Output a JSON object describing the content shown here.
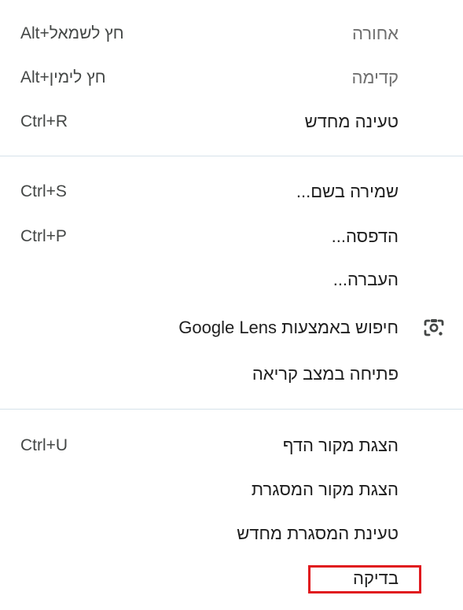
{
  "menu": {
    "items": [
      {
        "label": "אחורה",
        "shortcut": "Alt+חץ לשמאל"
      },
      {
        "label": "קדימה",
        "shortcut": "Alt+חץ לימין"
      },
      {
        "label": "טעינה מחדש",
        "shortcut": "Ctrl+R"
      },
      {
        "label": "שמירה בשם...",
        "shortcut": "Ctrl+S"
      },
      {
        "label": "הדפסה...",
        "shortcut": "Ctrl+P"
      },
      {
        "label": "העברה..."
      },
      {
        "label": "חיפוש באמצעות Google Lens",
        "icon": "google-lens-icon"
      },
      {
        "label": "פתיחה במצב קריאה"
      },
      {
        "label": "הצגת מקור הדף",
        "shortcut": "Ctrl+U"
      },
      {
        "label": "הצגת מקור המסגרת"
      },
      {
        "label": "טעינת המסגרת מחדש"
      },
      {
        "label": "בדיקה"
      }
    ]
  },
  "colors": {
    "text": "#1f1f1f",
    "disabled_text": "#6f6f6f",
    "divider": "#d6e2ea",
    "highlight": "#e0191e"
  }
}
